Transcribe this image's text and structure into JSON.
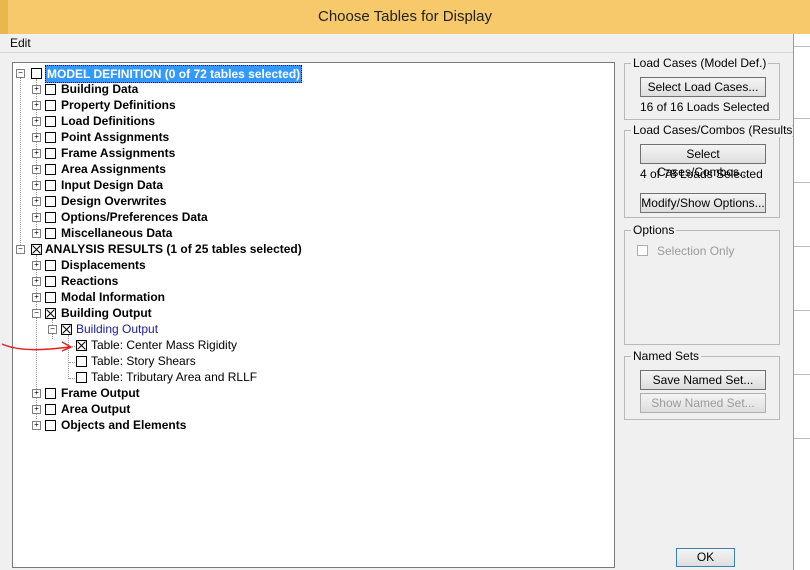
{
  "window": {
    "title": "Choose Tables for Display"
  },
  "menu": {
    "edit": "Edit"
  },
  "tree": {
    "model_definition": "MODEL DEFINITION  (0 of 72 tables selected)",
    "model_children": [
      "Building Data",
      "Property Definitions",
      "Load Definitions",
      "Point Assignments",
      "Frame Assignments",
      "Area Assignments",
      "Input Design Data",
      "Design Overwrites",
      "Options/Preferences Data",
      "Miscellaneous Data"
    ],
    "analysis_results": "ANALYSIS RESULTS  (1 of 25 tables selected)",
    "analysis_children": {
      "displacements": "Displacements",
      "reactions": "Reactions",
      "modal_information": "Modal Information",
      "building_output": "Building Output",
      "building_output_sub": "Building Output",
      "tables": [
        "Table:  Center Mass Rigidity",
        "Table:  Story Shears",
        "Table:  Tributary Area and RLLF"
      ],
      "frame_output": "Frame Output",
      "area_output": "Area Output",
      "objects_and_elements": "Objects and Elements"
    }
  },
  "load_cases": {
    "legend": "Load Cases (Model Def.)",
    "button": "Select Load Cases...",
    "status": "16  of  16  Loads Selected"
  },
  "load_combos": {
    "legend": "Load Cases/Combos (Results)",
    "button": "Select Cases/Combos...",
    "status": "4  of  78  Loads Selected",
    "modify_button": "Modify/Show Options..."
  },
  "options": {
    "legend": "Options",
    "selection_only": "Selection Only"
  },
  "named_sets": {
    "legend": "Named Sets",
    "save_button": "Save Named Set...",
    "show_button": "Show Named Set..."
  },
  "ok_button": "OK",
  "colors": {
    "highlight": "#3399ff",
    "titlebar": "#f7c96a",
    "annotation": "#e02020"
  }
}
